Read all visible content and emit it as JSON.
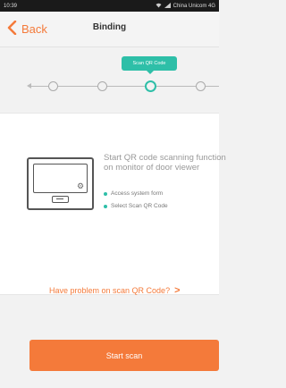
{
  "status_bar": {
    "time": "10:39",
    "carrier": "China Unicom 4G"
  },
  "nav": {
    "back_label": "Back",
    "title": "Binding"
  },
  "steps": {
    "current_label": "Scan QR Code",
    "total": 4,
    "active_index": 2
  },
  "instructions": {
    "text": "Start QR code scanning function on monitor of door viewer",
    "bullets": [
      "Access system form",
      "Select Scan QR Code"
    ]
  },
  "problem_link": {
    "label": "Have problem on scan QR Code?",
    "chevron": ">"
  },
  "start_button": {
    "label": "Start scan"
  },
  "colors": {
    "accent_orange": "#f47a3a",
    "accent_teal": "#2ebfa8"
  }
}
